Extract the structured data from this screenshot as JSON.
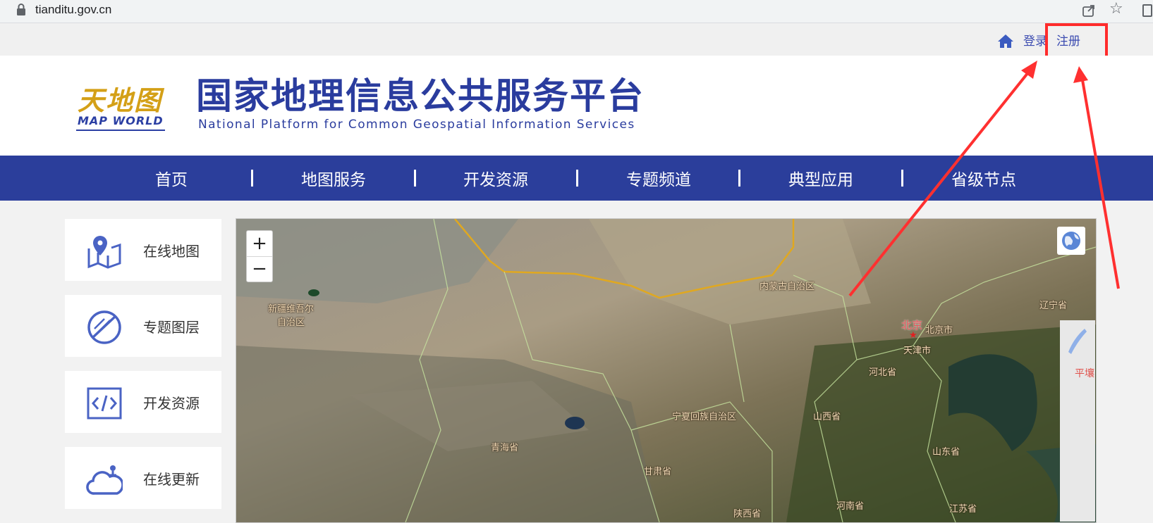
{
  "browser": {
    "url": "tianditu.gov.cn"
  },
  "topbar": {
    "login": "登录",
    "register": "注册"
  },
  "header": {
    "logo_cn": "天地图",
    "logo_en": "MAP WORLD",
    "title": "国家地理信息公共服务平台",
    "subtitle": "National Platform for Common Geospatial Information Services"
  },
  "nav": {
    "items": [
      {
        "label": "首页"
      },
      {
        "label": "地图服务"
      },
      {
        "label": "开发资源"
      },
      {
        "label": "专题频道"
      },
      {
        "label": "典型应用"
      },
      {
        "label": "省级节点"
      }
    ]
  },
  "sidebar": {
    "items": [
      {
        "label": "在线地图",
        "icon": "map-pin-icon"
      },
      {
        "label": "专题图层",
        "icon": "layer-slash-icon"
      },
      {
        "label": "开发资源",
        "icon": "code-icon"
      },
      {
        "label": "在线更新",
        "icon": "cloud-update-icon"
      }
    ]
  },
  "map": {
    "zoom_in": "+",
    "zoom_out": "−",
    "side_panel_text": "平壤",
    "labels": {
      "xinjiang": "新疆维吾尔\n自治区",
      "neimenggu": "内蒙古自治区",
      "liaoning": "辽宁省",
      "beijing_cn": "北京",
      "beijing_city": "北京市",
      "tianjin": "天津市",
      "hebei": "河北省",
      "ningxia": "宁夏回族自治区",
      "shanxi": "山西省",
      "qinghai": "青海省",
      "gansu": "甘肃省",
      "shandong": "山东省",
      "henan": "河南省",
      "shaanxi": "陕西省",
      "jiangsu": "江苏省"
    }
  },
  "colors": {
    "brand_blue": "#2b3e9b",
    "annotation_red": "#ff2b2b",
    "link_blue": "#3b4bb0"
  }
}
